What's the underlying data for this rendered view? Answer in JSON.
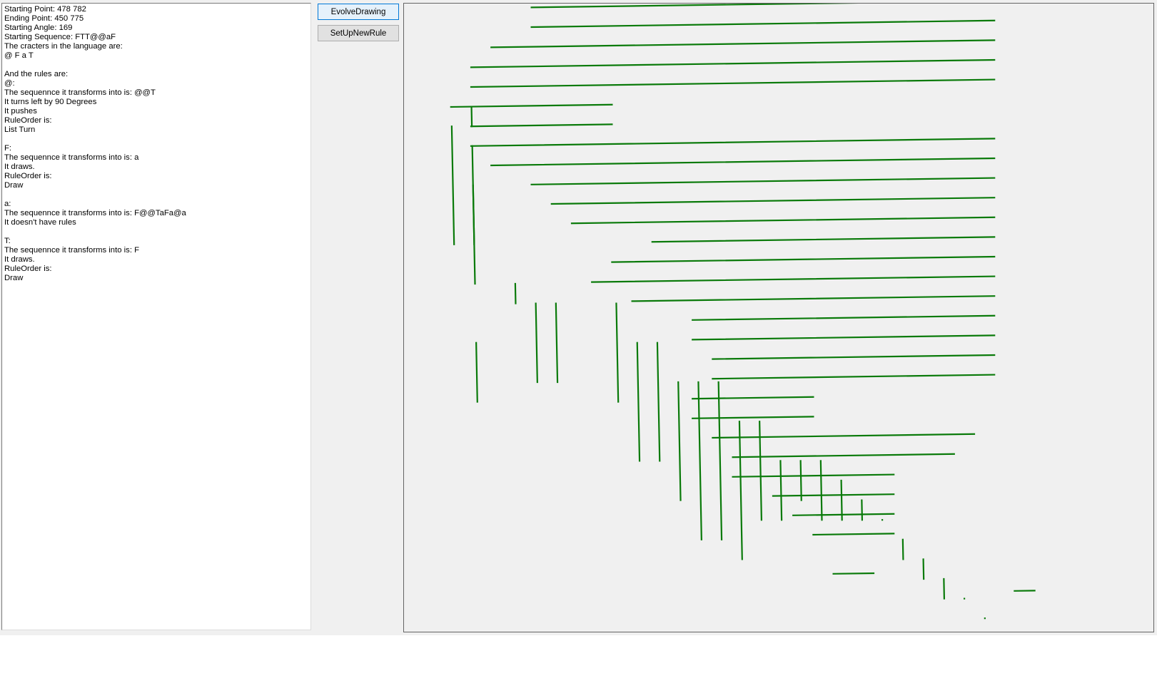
{
  "info": {
    "lines": [
      "Starting Point: 478 782",
      "Ending Point: 450 775",
      "Starting Angle: 169",
      "Starting Sequence: FTT@@aF",
      "The cracters in the language are:",
      "@ F a T",
      "",
      "And the rules are:",
      "@:",
      "The sequennce it transforms into is: @@T",
      "It turns left by 90 Degrees",
      "It pushes",
      "RuleOrder is:",
      "List Turn",
      "",
      "F:",
      "The sequennce it transforms into is: a",
      "It draws.",
      "RuleOrder is:",
      "Draw",
      "",
      "a:",
      "The sequennce it transforms into is: F@@TaFa@a",
      "It doesn't have rules",
      "",
      "T:",
      "The sequennce it transforms into is: F",
      "It draws.",
      "RuleOrder is:",
      "Draw"
    ]
  },
  "buttons": {
    "evolve_label": "EvolveDrawing",
    "setup_label": "SetUpNewRule"
  },
  "drawing": {
    "stroke_color": "#0a7a0a",
    "background_color": "#f0f0f0"
  }
}
